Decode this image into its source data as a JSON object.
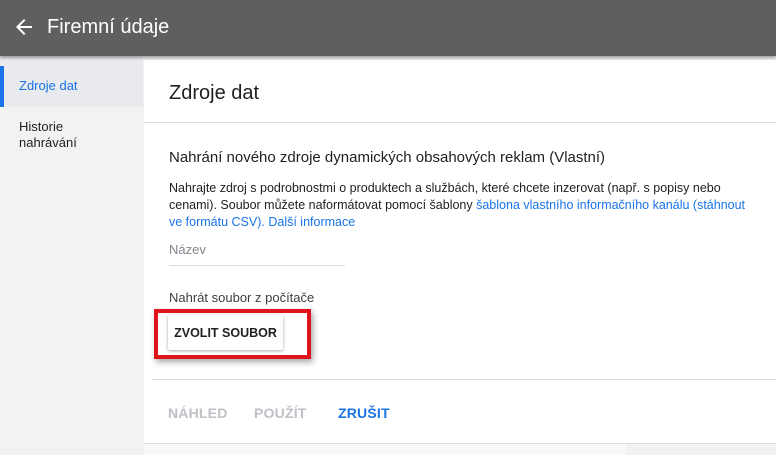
{
  "header": {
    "title": "Firemní údaje",
    "back_icon": "arrow-left-icon"
  },
  "sidebar": {
    "items": [
      {
        "label": "Zdroje dat",
        "active": true
      },
      {
        "label": "Historie nahrávání",
        "active": false
      }
    ]
  },
  "main": {
    "page_title": "Zdroje dat",
    "section_title": "Nahrání nového zdroje dynamických obsahových reklam (Vlastní)",
    "description": {
      "text": "Nahrajte zdroj s podrobnostmi o produktech a službách, které chcete inzerovat (např. s popisy nebo cenami). Soubor můžete naformátovat pomocí šablony ",
      "template_link": "šablona vlastního informačního kanálu (stáhnout ve formátu CSV).",
      "more_link": "Další informace"
    },
    "name_field": {
      "placeholder": "Název",
      "value": ""
    },
    "upload": {
      "label": "Nahrát soubor z počítače",
      "button_label": "ZVOLIT SOUBOR"
    },
    "footer": {
      "preview_label": "NÁHLED",
      "apply_label": "POUŽÍT",
      "cancel_label": "ZRUŠIT"
    }
  },
  "colors": {
    "topbar": "#5f5f5f",
    "accent": "#1a73e8",
    "highlight": "#e0141d",
    "disabled": "#bdc1c6"
  }
}
